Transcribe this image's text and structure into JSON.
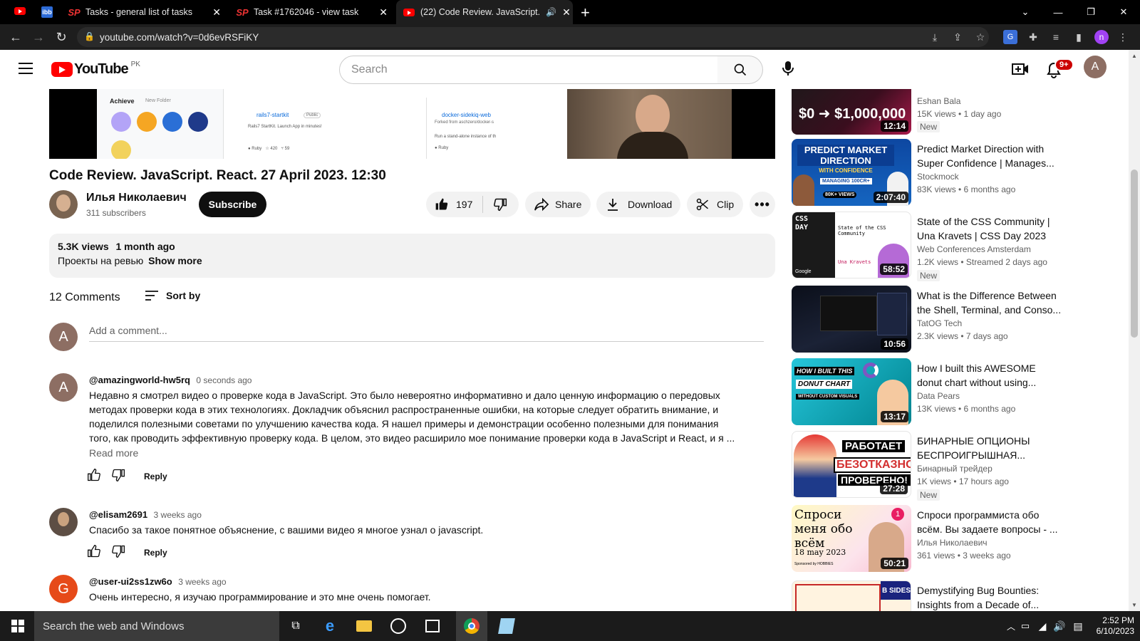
{
  "browser": {
    "tabs": [
      {
        "title": "Tasks - general list of tasks",
        "icon": "sp-icon"
      },
      {
        "title": "Task #1762046 - view task",
        "icon": "sp-icon"
      },
      {
        "title": "(22) Code Review. JavaScript.",
        "icon": "youtube-icon"
      }
    ],
    "url": "youtube.com/watch?v=0d6evRSFiKY",
    "profile_initial": "n"
  },
  "header": {
    "logo_text": "YouTube",
    "region": "PK",
    "search_placeholder": "Search",
    "notif_count": "9+",
    "avatar_initial": "A"
  },
  "video": {
    "title": "Code Review. JavaScript. React. 27 April 2023. 12:30",
    "channel": "Илья Николаевич",
    "subscribers": "311 subscribers",
    "subscribe_label": "Subscribe",
    "likes": "197",
    "share_label": "Share",
    "download_label": "Download",
    "clip_label": "Clip",
    "views": "5.3K views",
    "age": "1 month ago",
    "description": "Проекты на ревью",
    "show_more": "Show more",
    "screen_texts": {
      "achieve": "Achieve",
      "new_folder": "New Folder",
      "repo1": "rails7-startkit",
      "public": "Public",
      "repo1_desc": "Rails7 StartKit. Launch App in minutes!",
      "lang1": "Ruby",
      "stars1": "420",
      "forks1": "59",
      "repo2": "docker-sidekiq-web",
      "repo2_fork": "Forked from aschzero/docker-s",
      "repo2_desc": "Run a stand-alone instance of th",
      "lang2": "Ruby"
    }
  },
  "comments": {
    "count_label": "12 Comments",
    "sort_label": "Sort by",
    "add_placeholder": "Add a comment...",
    "user_initial": "A",
    "read_more": "Read more",
    "reply_label": "Reply",
    "items": [
      {
        "author": "@amazingworld-hw5rq",
        "time": "0 seconds ago",
        "initial": "A",
        "color": "#8d6e63",
        "lines": [
          "Недавно я смотрел видео о проверке кода в JavaScript. Это было невероятно информативно и дало ценную информацию о передовых",
          "методах проверки кода в этих технологиях. Докладчик объяснил распространенные ошибки, на которые следует обратить внимание, и",
          "поделился полезными советами по улучшению качества кода. Я нашел примеры и демонстрации особенно полезными для понимания",
          "того, как проводить эффективную проверку кода. В целом, это видео расширило мое понимание проверки кода в JavaScript и React, и я ..."
        ]
      },
      {
        "author": "@elisam2691",
        "time": "3 weeks ago",
        "initial": "",
        "color": "#5d4e44",
        "lines": [
          "Спасибо за такое понятное объяснение, с вашими видео я многое узнал о javascript."
        ]
      },
      {
        "author": "@user-ui2ss1zw6o",
        "time": "3 weeks ago",
        "initial": "G",
        "color": "#e64a19",
        "lines": [
          "Очень интересно, я изучаю программирование и это мне очень помогает."
        ]
      }
    ]
  },
  "related": [
    {
      "title": "",
      "channel": "Eshan Bala",
      "meta": "15K views • 1 day ago",
      "badge": "New",
      "duration": "12:14",
      "thumb_text": "$0 ➜ $1,000,000"
    },
    {
      "title": "Predict Market Direction with Super Confidence | Manages...",
      "channel": "Stockmock",
      "meta": "83K views • 6 months ago",
      "badge": "",
      "duration": "2:07:40",
      "thumb_text": "PREDICT MARKET DIRECTION",
      "thumb_sub": "WITH CONFIDENCE",
      "thumb_tag": "MANAGING 100CR+",
      "thumb_views": "80K+ VIEWS"
    },
    {
      "title": "State of the CSS Community | Una Kravets | CSS Day 2023",
      "channel": "Web Conferences Amsterdam",
      "meta": "1.2K views • Streamed 2 days ago",
      "badge": "New",
      "duration": "58:52",
      "thumb_text": "State of the CSS Community",
      "thumb_logo": "CSS DAY",
      "thumb_name": "Una Kravets",
      "thumb_brand": "Google"
    },
    {
      "title": "What is the Difference Between the Shell, Terminal, and Conso...",
      "channel": "TatOG Tech",
      "meta": "2.3K views • 7 days ago",
      "badge": "",
      "duration": "10:56"
    },
    {
      "title": "How I built this AWESOME donut chart without using...",
      "channel": "Data Pears",
      "meta": "13K views • 6 months ago",
      "badge": "",
      "duration": "13:17",
      "thumb_text": "HOW I BUILT THIS",
      "thumb_sub": "DONUT CHART",
      "thumb_tag": "WITHOUT CUSTOM VISUALS"
    },
    {
      "title": "БИНАРНЫЕ ОПЦИОНЫ БЕСПРОИГРЫШНАЯ...",
      "channel": "Бинарный трейдер",
      "meta": "1K views • 17 hours ago",
      "badge": "New",
      "duration": "27:28",
      "thumb_text": "РАБОТАЕТ",
      "thumb_sub": "БЕЗОТКАЗНО",
      "thumb_tag": "ПРОВЕРЕНО!"
    },
    {
      "title": "Спроси программиста обо всём. Вы задаете вопросы - ...",
      "channel": "Илья Николаевич",
      "meta": "361 views • 3 weeks ago",
      "badge": "",
      "duration": "50:21",
      "thumb_text": "Спроси меня обо всём",
      "thumb_sub": "18 may 2023",
      "thumb_tag": "Sponsored by HOBBIES",
      "thumb_num": "1"
    },
    {
      "title": "Demystifying Bug Bounties: Insights from a Decade of...",
      "channel": "",
      "meta": "",
      "badge": "",
      "duration": "",
      "thumb_text": "B SIDES"
    }
  ],
  "taskbar": {
    "search_placeholder": "Search the web and Windows",
    "time": "2:52 PM",
    "date": "6/10/2023"
  }
}
